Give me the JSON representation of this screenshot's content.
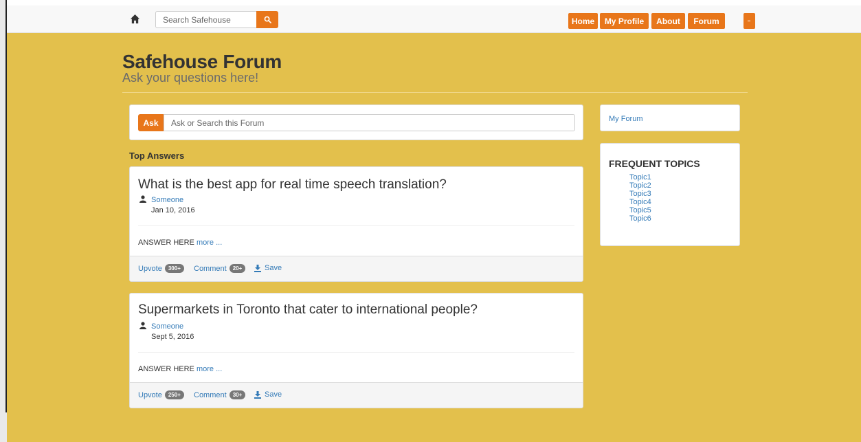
{
  "nav": {
    "search_placeholder": "Search Safehouse",
    "buttons": [
      "Home",
      "My Profile",
      "About",
      "Forum"
    ]
  },
  "header": {
    "title": "Safehouse Forum",
    "subtitle": "Ask your questions here!"
  },
  "ask": {
    "button_label": "Ask",
    "placeholder": "Ask or Search this Forum"
  },
  "section_label": "Top Answers",
  "questions": [
    {
      "title": "What is the best app for real time speech translation?",
      "author": "Someone",
      "date": "Jan 10, 2016",
      "answer": "ANSWER HERE",
      "more": "more ...",
      "upvote_label": "Upvote",
      "upvote_count": "300+",
      "comment_label": "Comment",
      "comment_count": "20+",
      "save_label": "Save"
    },
    {
      "title": "Supermarkets in Toronto that cater to international people?",
      "author": "Someone",
      "date": "Sept 5, 2016",
      "answer": "ANSWER HERE",
      "more": "more ...",
      "upvote_label": "Upvote",
      "upvote_count": "250+",
      "comment_label": "Comment",
      "comment_count": "30+",
      "save_label": "Save"
    }
  ],
  "sidebar": {
    "my_forum": "My Forum",
    "frequent_title": "FREQUENT TOPICS",
    "topics": [
      "Topic1",
      "Topic2",
      "Topic3",
      "Topic4",
      "Topic5",
      "Topic6"
    ]
  },
  "colors": {
    "background": "#e3c04c",
    "accent": "#e8761a",
    "link": "#337ab7"
  },
  "icons": [
    "home-icon",
    "search-icon",
    "user-icon",
    "download-icon",
    "caret-down-icon"
  ]
}
